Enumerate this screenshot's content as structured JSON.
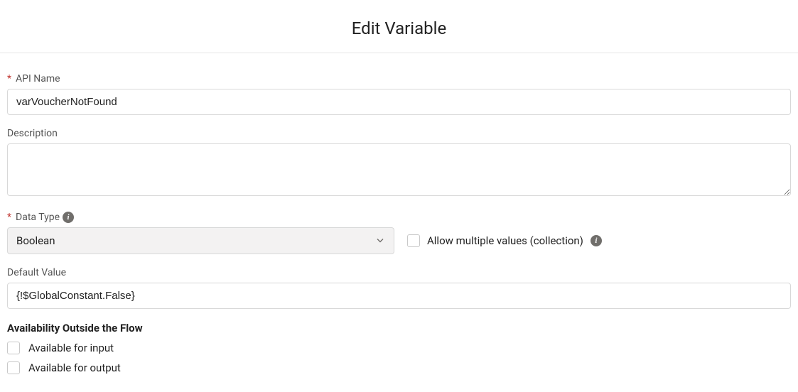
{
  "header": {
    "title": "Edit Variable"
  },
  "fields": {
    "api_name": {
      "label": "API Name",
      "value": "varVoucherNotFound",
      "required": true
    },
    "description": {
      "label": "Description",
      "value": ""
    },
    "data_type": {
      "label": "Data Type",
      "value": "Boolean",
      "required": true
    },
    "multiple_values": {
      "label": "Allow multiple values (collection)",
      "checked": false
    },
    "default_value": {
      "label": "Default Value",
      "value": "{!$GlobalConstant.False}"
    }
  },
  "availability": {
    "header": "Availability Outside the Flow",
    "input": {
      "label": "Available for input",
      "checked": false
    },
    "output": {
      "label": "Available for output",
      "checked": false
    }
  }
}
